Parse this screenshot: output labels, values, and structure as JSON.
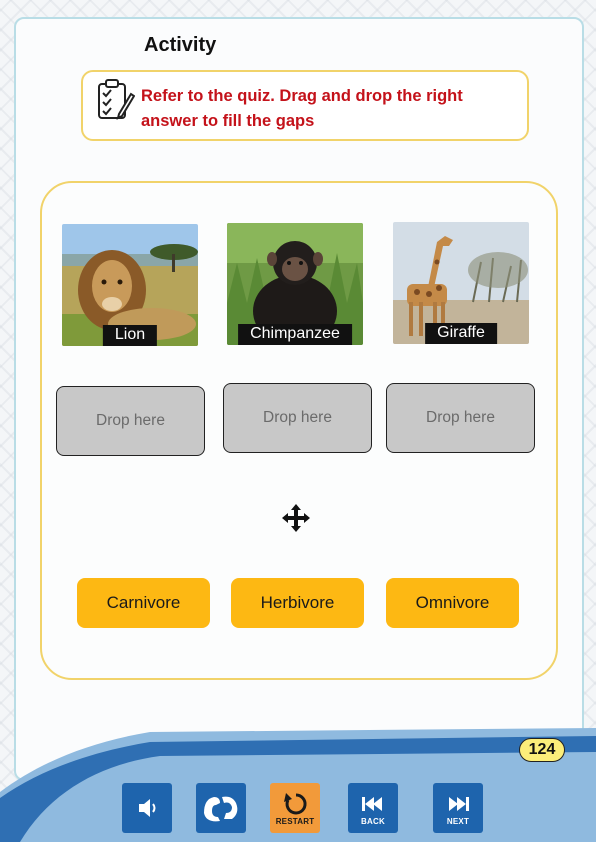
{
  "activity": {
    "title": "Activity",
    "instruction": "Refer to the quiz. Drag and drop the right answer to fill the gaps"
  },
  "animals": [
    {
      "label": "Lion",
      "icon": "lion-photo"
    },
    {
      "label": "Chimpanzee",
      "icon": "chimpanzee-photo"
    },
    {
      "label": "Giraffe",
      "icon": "giraffe-photo"
    }
  ],
  "drop_zones": [
    {
      "placeholder": "Drop here"
    },
    {
      "placeholder": "Drop here"
    },
    {
      "placeholder": "Drop here"
    }
  ],
  "answers": [
    "Carnivore",
    "Herbivore",
    "Omnivore"
  ],
  "page_number": "124",
  "controls": {
    "sound_icon": "speaker-icon",
    "sign_language_icon": "sign-language-icon",
    "restart_label": "RESTART",
    "back_label": "BACK",
    "next_label": "NEXT"
  },
  "colors": {
    "answer_button": "#fdb813",
    "instruction_text": "#c4121a",
    "control_button": "#1e64ad",
    "restart_button": "#f29a3a",
    "panel_border": "#f1d36a"
  }
}
